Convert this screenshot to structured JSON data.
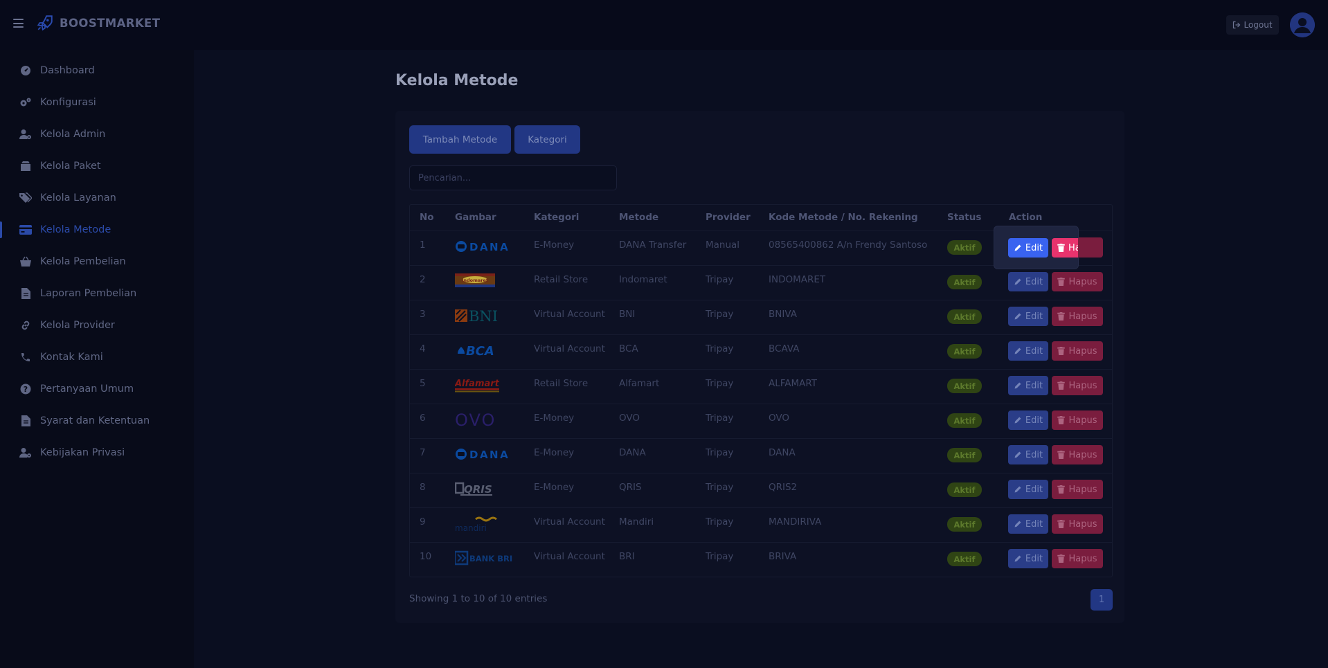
{
  "brand": {
    "name": "BOOSTMARKET"
  },
  "header": {
    "logout_label": "Logout"
  },
  "sidebar": {
    "items": [
      {
        "label": "Dashboard",
        "icon": "gauge-icon"
      },
      {
        "label": "Konfigurasi",
        "icon": "gears-icon"
      },
      {
        "label": "Kelola Admin",
        "icon": "user-gear-icon"
      },
      {
        "label": "Kelola Paket",
        "icon": "box-icon"
      },
      {
        "label": "Kelola Layanan",
        "icon": "tags-icon"
      },
      {
        "label": "Kelola Metode",
        "icon": "credit-card-icon",
        "active": true
      },
      {
        "label": "Kelola Pembelian",
        "icon": "basket-icon"
      },
      {
        "label": "Laporan Pembelian",
        "icon": "file-icon"
      },
      {
        "label": "Kelola Provider",
        "icon": "link-icon"
      },
      {
        "label": "Kontak Kami",
        "icon": "phone-icon"
      },
      {
        "label": "Pertanyaan Umum",
        "icon": "question-icon"
      },
      {
        "label": "Syarat dan Ketentuan",
        "icon": "file-icon"
      },
      {
        "label": "Kebijakan Privasi",
        "icon": "user-gear-icon"
      }
    ]
  },
  "page": {
    "title": "Kelola Metode",
    "add_button": "Tambah Metode",
    "category_button": "Kategori",
    "search_placeholder": "Pencarian...",
    "showing": "Showing 1 to 10 of 10 entries",
    "current_page": "1"
  },
  "table": {
    "headers": [
      "No",
      "Gambar",
      "Kategori",
      "Metode",
      "Provider",
      "Kode Metode / No. Rekening",
      "Status",
      "Action"
    ],
    "edit_label": "Edit",
    "delete_label": "Hapus",
    "rows": [
      {
        "no": "1",
        "logo": "DANA",
        "kategori": "E-Money",
        "metode": "DANA Transfer",
        "provider": "Manual",
        "kode": "08565400862 A/n Frendy Santoso",
        "status": "Aktif"
      },
      {
        "no": "2",
        "logo": "Indomaret",
        "kategori": "Retail Store",
        "metode": "Indomaret",
        "provider": "Tripay",
        "kode": "INDOMARET",
        "status": "Aktif"
      },
      {
        "no": "3",
        "logo": "BNI",
        "kategori": "Virtual Account",
        "metode": "BNI",
        "provider": "Tripay",
        "kode": "BNIVA",
        "status": "Aktif"
      },
      {
        "no": "4",
        "logo": "BCA",
        "kategori": "Virtual Account",
        "metode": "BCA",
        "provider": "Tripay",
        "kode": "BCAVA",
        "status": "Aktif"
      },
      {
        "no": "5",
        "logo": "Alfamart",
        "kategori": "Retail Store",
        "metode": "Alfamart",
        "provider": "Tripay",
        "kode": "ALFAMART",
        "status": "Aktif"
      },
      {
        "no": "6",
        "logo": "OVO",
        "kategori": "E-Money",
        "metode": "OVO",
        "provider": "Tripay",
        "kode": "OVO",
        "status": "Aktif"
      },
      {
        "no": "7",
        "logo": "DANA",
        "kategori": "E-Money",
        "metode": "DANA",
        "provider": "Tripay",
        "kode": "DANA",
        "status": "Aktif"
      },
      {
        "no": "8",
        "logo": "QRIS",
        "kategori": "E-Money",
        "metode": "QRIS",
        "provider": "Tripay",
        "kode": "QRIS2",
        "status": "Aktif"
      },
      {
        "no": "9",
        "logo": "mandiri",
        "kategori": "Virtual Account",
        "metode": "Mandiri",
        "provider": "Tripay",
        "kode": "MANDIRIVA",
        "status": "Aktif"
      },
      {
        "no": "10",
        "logo": "BANK BRI",
        "kategori": "Virtual Account",
        "metode": "BRI",
        "provider": "Tripay",
        "kode": "BRIVA",
        "status": "Aktif"
      }
    ]
  },
  "colors": {
    "accent": "#3963f0",
    "danger": "#e8336d",
    "success": "#2f4414",
    "background": "#0a0e20"
  }
}
